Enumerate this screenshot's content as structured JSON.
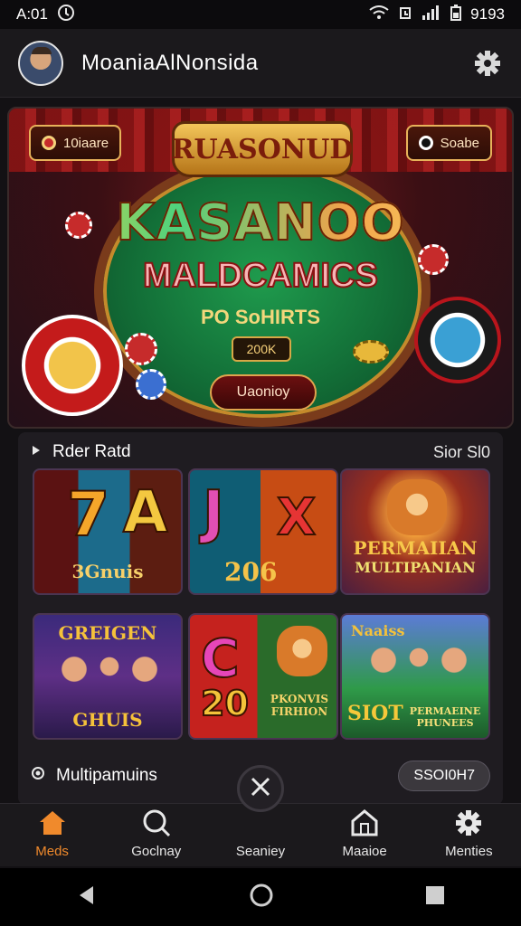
{
  "status_bar": {
    "time": "A:01",
    "battery_text": "9193"
  },
  "header": {
    "title": "MoaniaAlNonsida"
  },
  "hero": {
    "banner_text": "RUASONUD",
    "title": "KASANOO",
    "subtitle": "MALDCAMICS",
    "tagline": "PO SoHIRTS",
    "amount": "200K",
    "cta_label": "Uaonioy",
    "left_button_label": "10iaare",
    "right_button_label": "Soabe"
  },
  "games_section": {
    "title": "Rder Ratd",
    "link_label": "Sior Sl0",
    "cards": [
      {
        "sym_a": "7",
        "sym_b": "A",
        "label": "3Gnuis"
      },
      {
        "sym_a": "J",
        "sym_b": "X",
        "label": "206"
      },
      {
        "title": "PERMAIIAN",
        "label": "MULTIPANIAN"
      },
      {
        "title": "GREIGEN",
        "label": "GHUIS"
      },
      {
        "sym_a": "C",
        "sym_b": "20",
        "label": "PKONVIS FIRHION"
      },
      {
        "title": "Naaiss",
        "sym_a": "SIOT",
        "label": "PERMAEINE PHUNEES"
      }
    ]
  },
  "multiplayer_section": {
    "title": "Multipamuins",
    "button_label": "SSOI0H7"
  },
  "bottom_nav": {
    "items": [
      {
        "label": "Meds",
        "active": true
      },
      {
        "label": "Goclnay"
      },
      {
        "label": "Seaniey"
      },
      {
        "label": "Maaioe"
      },
      {
        "label": "Menties"
      }
    ]
  },
  "colors": {
    "accent": "#f08a2c",
    "background": "#131114",
    "panel": "#1f1c21"
  }
}
